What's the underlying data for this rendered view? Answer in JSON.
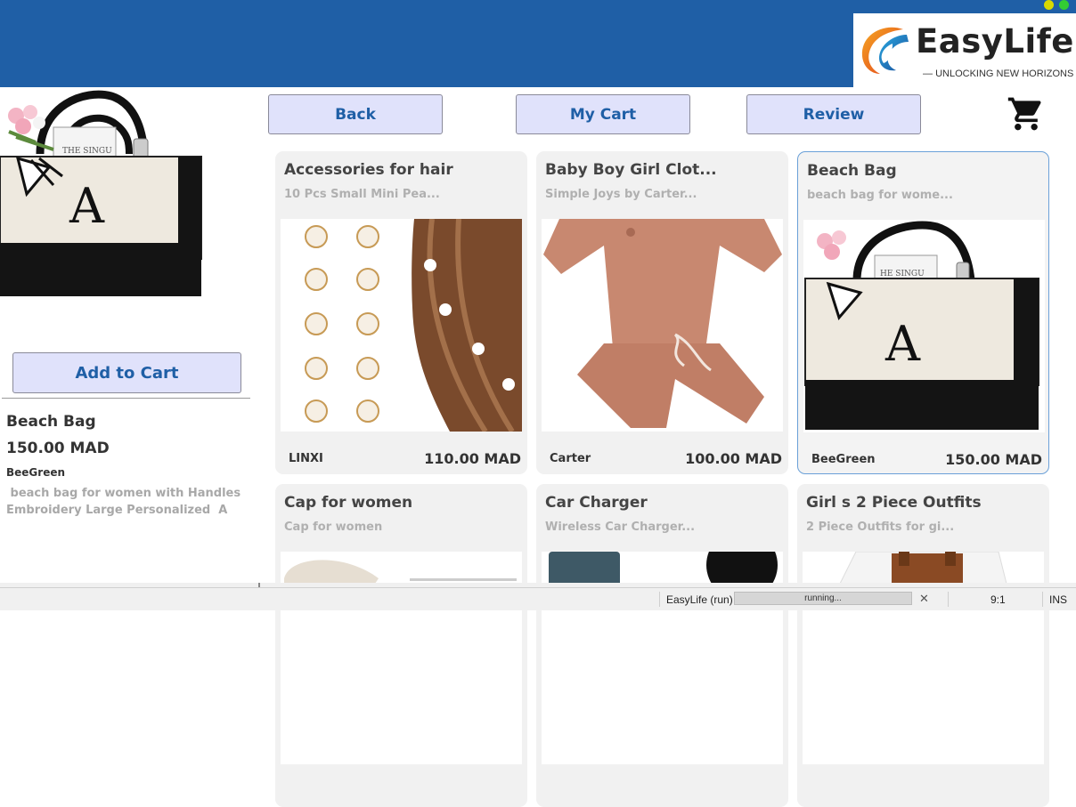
{
  "window": {
    "dot_colors": [
      "#d8d800",
      "#33cc33"
    ]
  },
  "logo": {
    "name": "EasyLife",
    "tagline": "UNLOCKING NEW HORIZONS"
  },
  "nav": {
    "back_label": "Back",
    "cart_label": "My Cart",
    "review_label": "Review",
    "cart_icon": "shopping-cart-icon"
  },
  "detail": {
    "add_to_cart_label": "Add to Cart",
    "name": "Beach Bag",
    "price": "150.00 MAD",
    "brand": "BeeGreen",
    "description": " beach bag for women with Handles\nEmbroidery Large Personalized  A",
    "bag_letter": "A"
  },
  "products": [
    {
      "title": "Accessories for hair",
      "subtitle": "10 Pcs Small Mini Pea...",
      "brand": "LINXI",
      "price": "110.00 MAD",
      "image": "hair-accessories"
    },
    {
      "title": "Baby Boy Girl Clot...",
      "subtitle": "Simple Joys by Carter...",
      "brand": "Carter",
      "price": "100.00 MAD",
      "image": "baby-outfit"
    },
    {
      "title": "Beach Bag",
      "subtitle": " beach bag for wome...",
      "brand": "BeeGreen",
      "price": "150.00 MAD",
      "image": "beach-bag",
      "selected": true,
      "bag_letter": "A"
    },
    {
      "title": "Cap for women",
      "subtitle": "Cap for women",
      "image": "cap"
    },
    {
      "title": "Car Charger",
      "subtitle": "Wireless Car Charger...",
      "image": "car-charger"
    },
    {
      "title": "Girl s 2 Piece Outfits",
      "subtitle": " 2 Piece Outfits for gi...",
      "image": "girl-outfit"
    }
  ],
  "status": {
    "app": "EasyLife (run)",
    "progress_text": "running...",
    "position": "9:1",
    "mode": "INS"
  },
  "colors": {
    "header_blue": "#1f5fa6",
    "button_bg": "#e0e2fb",
    "button_text": "#1f5fa6",
    "card_bg": "#f1f1f1",
    "selected_border": "#6aa0d8"
  }
}
